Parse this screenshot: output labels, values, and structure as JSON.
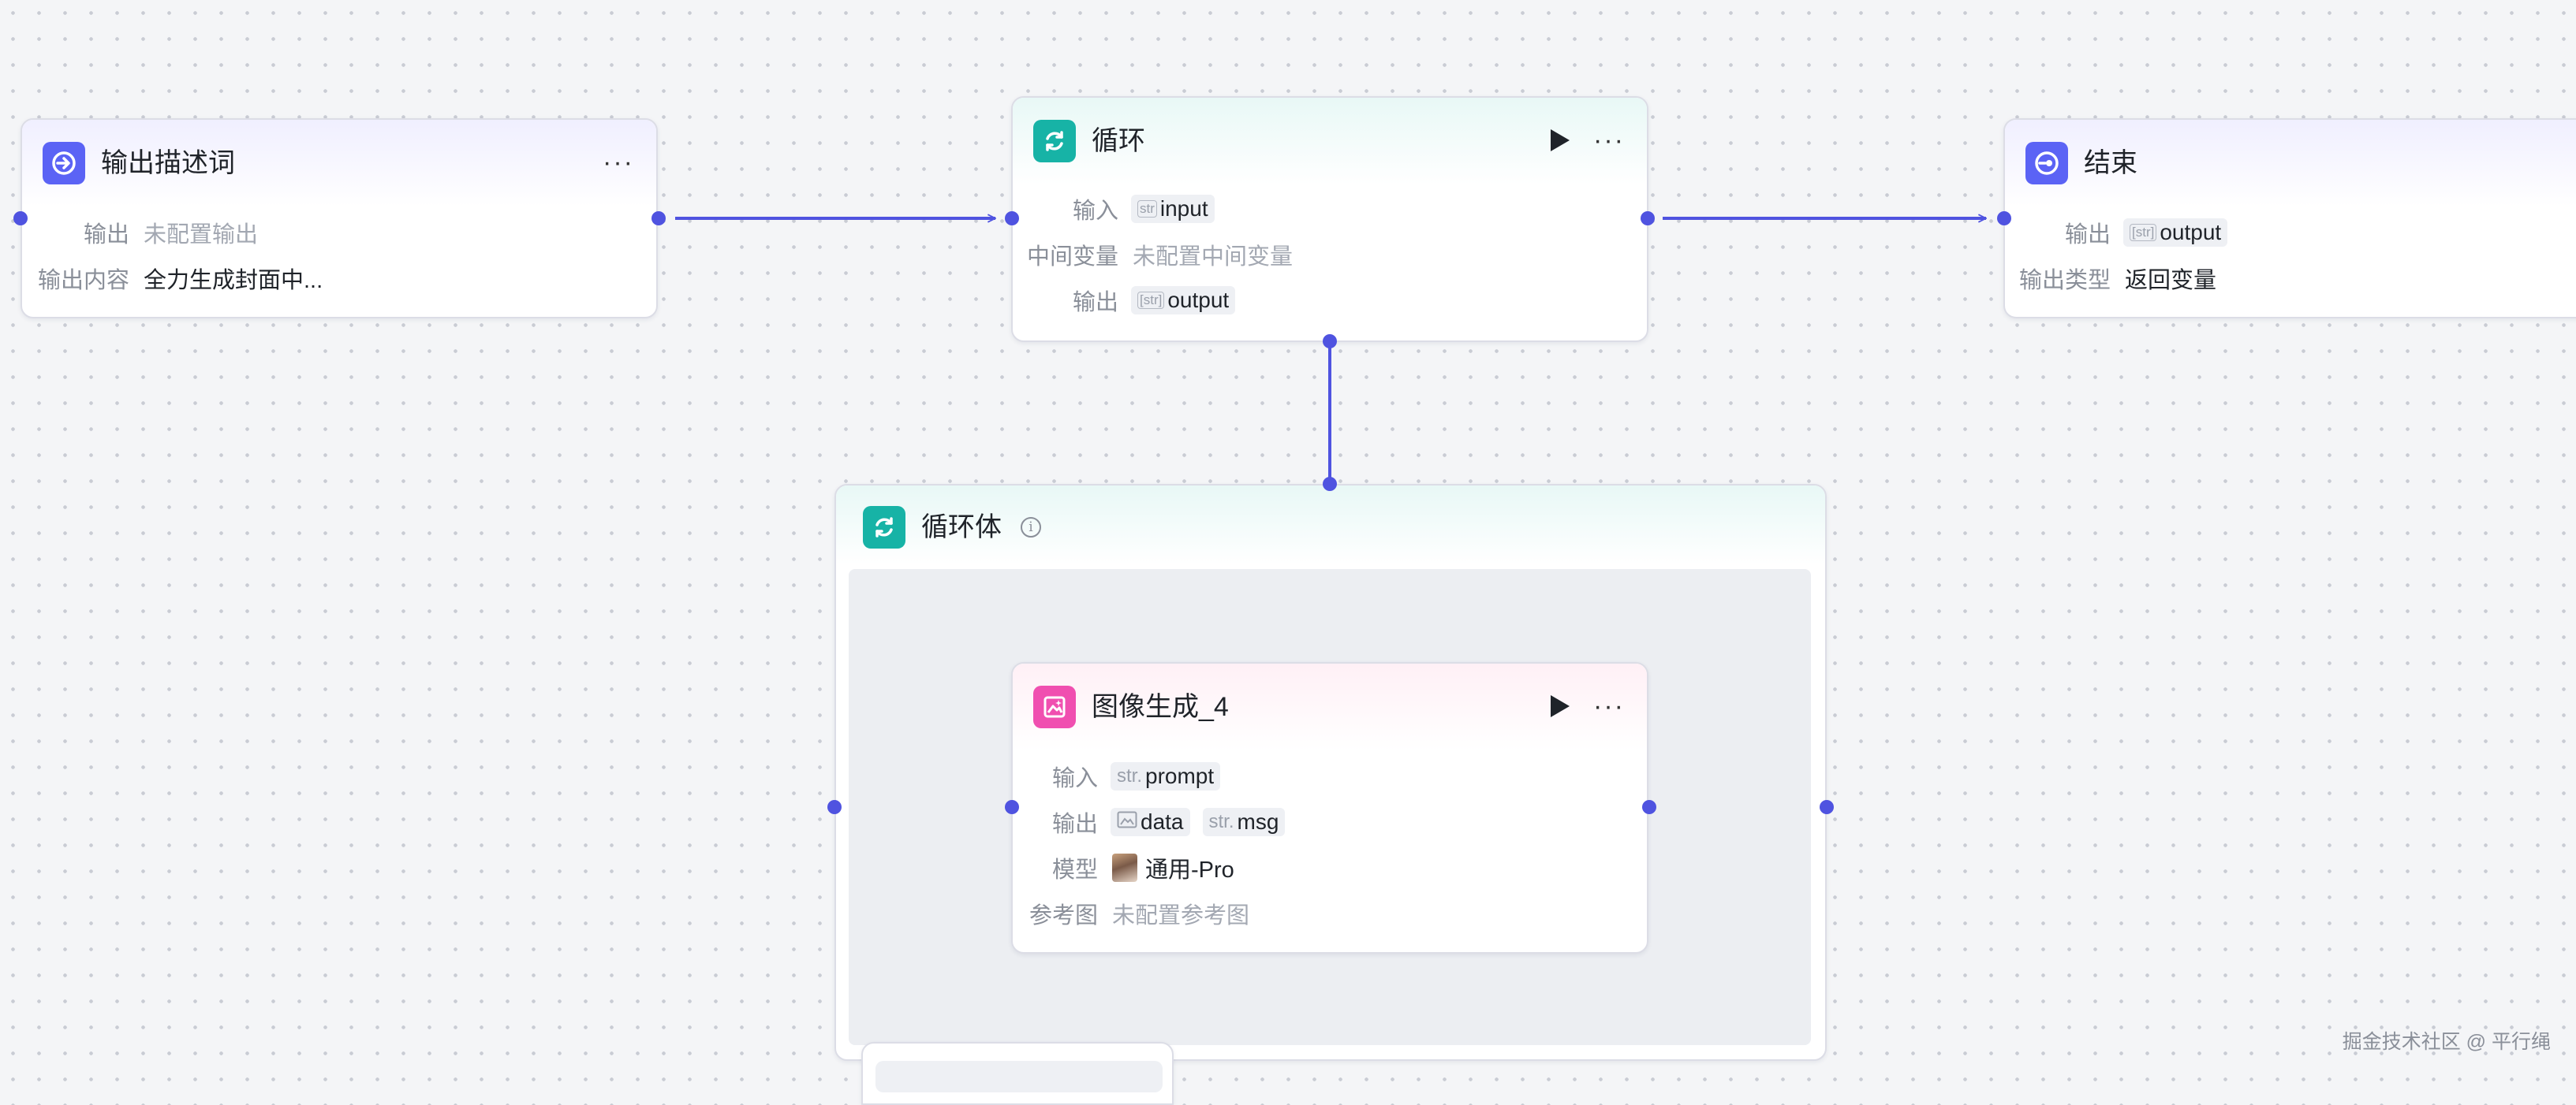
{
  "nodes": {
    "output_desc": {
      "title": "输出描述词",
      "rows": [
        {
          "label": "输出",
          "value": "未配置输出"
        },
        {
          "label": "输出内容",
          "value": "全力生成封面中..."
        }
      ]
    },
    "loop": {
      "title": "循环",
      "input_label": "输入",
      "input_type": "str",
      "input_value": "input",
      "mid_label": "中间变量",
      "mid_value": "未配置中间变量",
      "output_label": "输出",
      "output_type": "[str]",
      "output_value": "output"
    },
    "end": {
      "title": "结束",
      "output_label": "输出",
      "output_type": "[str]",
      "output_value": "output",
      "type_label": "输出类型",
      "type_value": "返回变量"
    },
    "loop_body": {
      "title": "循环体"
    },
    "image_gen": {
      "title": "图像生成_4",
      "input_label": "输入",
      "input_type": "str.",
      "input_value": "prompt",
      "output_label": "输出",
      "output_values": [
        {
          "type": "image",
          "value": "data"
        },
        {
          "type": "str.",
          "value": "msg"
        }
      ],
      "model_label": "模型",
      "model_value": "通用-Pro",
      "ref_label": "参考图",
      "ref_value": "未配置参考图"
    }
  },
  "watermark": "掘金技术社区 @ 平行绳",
  "colors": {
    "edge": "#4f53e0",
    "accent_purple": "#5b63f5",
    "accent_teal": "#17b3a6",
    "accent_pink": "#f04fb0"
  }
}
